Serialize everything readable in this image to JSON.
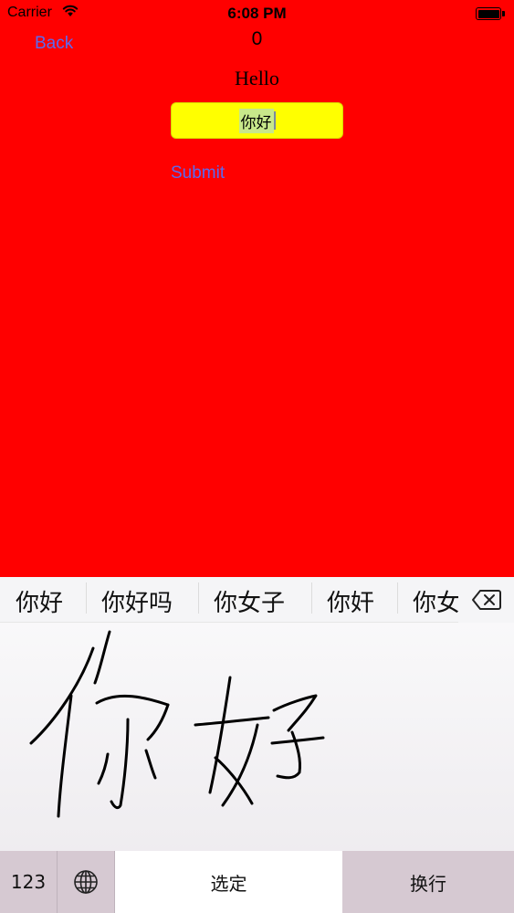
{
  "status_bar": {
    "carrier": "Carrier",
    "time": "6:08 PM"
  },
  "nav": {
    "back_label": "Back"
  },
  "screen": {
    "counter": "0",
    "greeting": "Hello",
    "text_field_value": "你好",
    "submit_label": "Submit"
  },
  "keyboard": {
    "candidates": [
      "你好",
      "你好吗",
      "你女子",
      "你奸",
      "你女"
    ],
    "keys": {
      "numbers": "123",
      "select": "选定",
      "return": "换行"
    },
    "icons": {
      "globe": "globe-icon",
      "delete": "delete-backward-icon"
    },
    "handwriting_ink_color": "#000000"
  },
  "colors": {
    "background": "#ff0000",
    "text_field": "#ffff00",
    "link": "#5a6af0"
  }
}
